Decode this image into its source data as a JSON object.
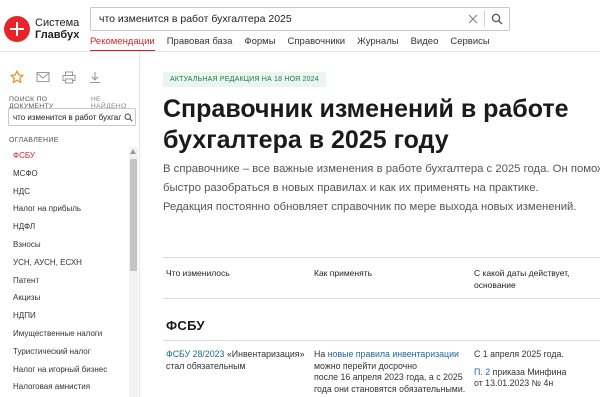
{
  "logo": {
    "line1": "Система",
    "line2": "Главбух"
  },
  "search": {
    "value": "что изменится в работ бухгалтера 2025"
  },
  "nav": [
    {
      "label": "Рекомендации",
      "active": true
    },
    {
      "label": "Правовая база"
    },
    {
      "label": "Формы"
    },
    {
      "label": "Справочники"
    },
    {
      "label": "Журналы"
    },
    {
      "label": "Видео"
    },
    {
      "label": "Сервисы"
    }
  ],
  "sidebar": {
    "search_label": "ПОИСК ПО ДОКУМЕНТУ",
    "not_found": "НЕ НАЙДЕНО",
    "search_value": "что изменится в работ бухгалте",
    "toc_title": "ОГЛАВЛЕНИЕ",
    "toc": [
      "ФСБУ",
      "МСФО",
      "НДС",
      "Налог на прибыль",
      "НДФЛ",
      "Взносы",
      "УСН, АУСН, ЕСХН",
      "Патент",
      "Акцизы",
      "НДПИ",
      "Имущественные налоги",
      "Туристический налог",
      "Налог на игорный бизнес",
      "Налоговая амнистия"
    ]
  },
  "main": {
    "badge": "АКТУАЛЬНАЯ РЕДАКЦИЯ НА 18 НОЯ 2024",
    "title": "Справочник изменений в работе бухгалтера в 2025 году",
    "lead_1": "В справочнике – все важные изменения в работе бухгалтера с 2025 года. Он поможет",
    "lead_2": "быстро разобраться в новых правилах и как их применять на практике.",
    "lead_3": "Редакция постоянно обновляет справочник по мере выхода новых изменений.",
    "table": {
      "headers": [
        "Что изменилось",
        "Как применять",
        "С какой даты действует, основание"
      ],
      "section": "ФСБУ",
      "row": {
        "c1_link": "ФСБУ 28/2023",
        "c1_text_1": " «Инвентаризация»",
        "c1_text_2": "стал обязательным",
        "c2_pre": "На ",
        "c2_link": "новые правила инвентаризации",
        "c2_text_1": "можно перейти досрочно",
        "c2_text_2": "после 16 апреля 2023 года, а с 2025",
        "c2_text_3": "года они становятся обязательными.",
        "c3_text_1": "С 1 апреля 2025 года.",
        "c3_link": "П. 2",
        "c3_text_2": " приказа Минфина",
        "c3_text_3": "от 13.01.2023 № 4н"
      }
    }
  },
  "colors": {
    "accent": "#d6242a",
    "badge_bg": "#eaf5ef",
    "badge_text": "#1d7a4a",
    "link": "#1a6a9a"
  }
}
